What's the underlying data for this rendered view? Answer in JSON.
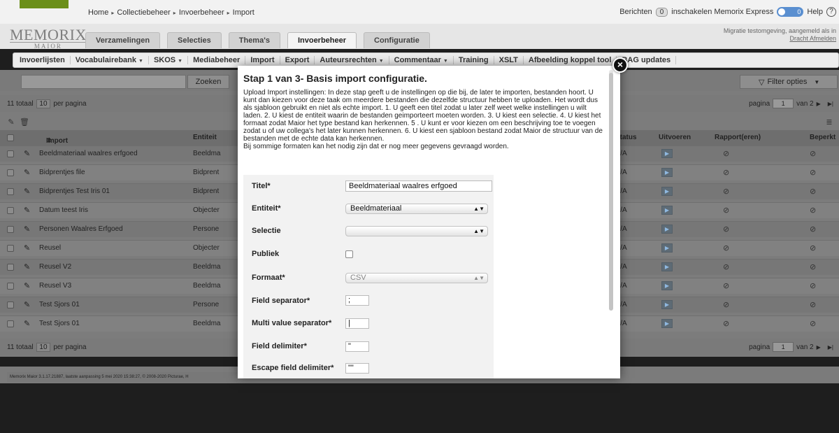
{
  "topbar": {
    "breadcrumb": [
      "Home",
      "Collectiebeheer",
      "Invoerbeheer",
      "Import"
    ],
    "berichten_label": "Berichten",
    "berichten_count": "0",
    "express_label": "inschakelen Memorix Express",
    "express_count": "0",
    "help_label": "Help"
  },
  "header": {
    "logo": "MEMORIX",
    "logo_sub": "MAIOR",
    "tabs": [
      "Verzamelingen",
      "Selecties",
      "Thema's",
      "Invoerbeheer",
      "Configuratie"
    ],
    "active_tab": "Invoerbeheer",
    "env_text": "Migratie testomgeving, aangemeld als in",
    "logout_link": "Dracht Afmelden"
  },
  "subnav": {
    "items": [
      "Invoerlijsten",
      "Vocabulairebank",
      "SKOS",
      "Mediabeheer",
      "Import",
      "Export",
      "Auteursrechten",
      "Commentaar",
      "Training",
      "XSLT",
      "Afbeelding koppel tool",
      "BAG updates"
    ]
  },
  "toolbar": {
    "search_button": "Zoeken",
    "filter_button": "Filter opties"
  },
  "pager": {
    "total": "11 totaal",
    "per_page_value": "10",
    "per_page_label": "per pagina",
    "page_label": "pagina",
    "page_value": "1",
    "of_label": "van 2"
  },
  "table": {
    "headers": {
      "import": "Import",
      "entity": "Entiteit",
      "status": "Status",
      "run": "Uitvoeren",
      "report": "Rapport(eren)",
      "restricted": "Beperkt"
    },
    "rows": [
      {
        "name": "Beeldmateriaal waalres erfgoed",
        "entity": "Beeldma",
        "status": "N/A"
      },
      {
        "name": "Bidprentjes file",
        "entity": "Bidprent",
        "status": "N/A"
      },
      {
        "name": "Bidprentjes Test Iris 01",
        "entity": "Bidprent",
        "status": "N/A"
      },
      {
        "name": "Datum teest Iris",
        "entity": "Objecter",
        "status": "N/A"
      },
      {
        "name": "Personen Waalres Erfgoed",
        "entity": "Persone",
        "status": "N/A"
      },
      {
        "name": "Reusel",
        "entity": "Objecter",
        "status": "N/A"
      },
      {
        "name": "Reusel V2",
        "entity": "Beeldma",
        "status": "N/A"
      },
      {
        "name": "Reusel V3",
        "entity": "Beeldma",
        "status": "N/A"
      },
      {
        "name": "Test Sjors 01",
        "entity": "Persone",
        "status": "N/A"
      },
      {
        "name": "Test Sjors 01",
        "entity": "Beeldma",
        "status": "N/A"
      }
    ]
  },
  "footer": {
    "text": "Memorix Maior 3.1.17.21887, laatste aanpassing 5 mei 2020 15:38:27, © 2008-2020 Picturae, H"
  },
  "modal": {
    "title": "Stap 1 van 3- Basis import configuratie.",
    "description": "Upload Import instellingen: In deze stap geeft u de instellingen op die bij, de later te importen, bestanden hoort. U kunt dan kiezen voor deze taak om meerdere bestanden die dezelfde structuur hebben te uploaden. Het wordt dus als sjabloon gebruikt en niet als echte import. 1. U geeft een titel zodat u later zelf weet welke instellingen u wilt laden. 2. U kiest de entiteit waarin de bestanden geimporteert moeten worden. 3. U kiest een selectie. 4. U kiest het formaat zodat Maior het type bestand kan herkennen. 5 . U kunt er voor kiezen om een beschrijving toe te voegen zodat u of uw collega's het later kunnen herkennen. 6. U kiest een sjabloon bestand zodat Maior de structuur van de bestanden met de echte data kan herkennen.",
    "description2": "Bij sommige formaten kan het nodig zijn dat er nog meer gegevens gevraagd worden.",
    "fields": {
      "title_label": "Titel*",
      "title_value": "Beeldmateriaal waalres erfgoed",
      "entity_label": "Entiteit*",
      "entity_value": "Beeldmateriaal",
      "selection_label": "Selectie",
      "selection_value": "",
      "public_label": "Publiek",
      "format_label": "Formaat*",
      "format_value": "CSV",
      "field_sep_label": "Field separator*",
      "field_sep_value": ";",
      "multi_sep_label": "Multi value separator*",
      "multi_sep_value": "|",
      "field_delim_label": "Field delimiter*",
      "field_delim_value": "\"",
      "escape_delim_label": "Escape field delimiter*",
      "escape_delim_value": "\"\""
    },
    "close_symbol": "×"
  }
}
